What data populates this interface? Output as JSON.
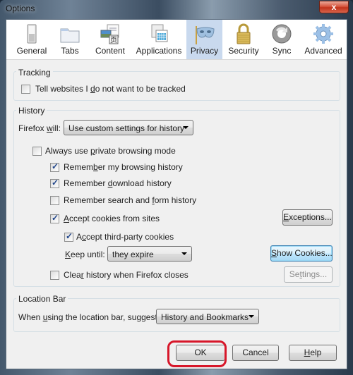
{
  "window": {
    "title": "Options",
    "close_glyph": "x"
  },
  "toolbar": {
    "panes": [
      {
        "id": "general",
        "label": "General",
        "icon": "switch-icon",
        "selected": false
      },
      {
        "id": "tabs",
        "label": "Tabs",
        "icon": "folder-tab-icon",
        "selected": false
      },
      {
        "id": "content",
        "label": "Content",
        "icon": "content-page-icon",
        "selected": false
      },
      {
        "id": "applications",
        "label": "Applications",
        "icon": "applications-icon",
        "selected": false
      },
      {
        "id": "privacy",
        "label": "Privacy",
        "icon": "mask-icon",
        "selected": true
      },
      {
        "id": "security",
        "label": "Security",
        "icon": "padlock-icon",
        "selected": false
      },
      {
        "id": "sync",
        "label": "Sync",
        "icon": "sync-icon",
        "selected": false
      },
      {
        "id": "advanced",
        "label": "Advanced",
        "icon": "gear-icon",
        "selected": false
      }
    ]
  },
  "tracking": {
    "caption": "Tracking",
    "do_not_track": {
      "pre": "Tell websites I ",
      "accel": "d",
      "post": "o not want to be tracked",
      "checked": false
    }
  },
  "history": {
    "caption": "History",
    "firefox_will_label": {
      "pre": "Firefox ",
      "accel": "w",
      "post": "ill:"
    },
    "firefox_will_value": "Use custom settings for history",
    "private_mode": {
      "pre": "Always use ",
      "accel": "p",
      "post": "rivate browsing mode",
      "checked": false
    },
    "remember_browsing": {
      "pre": "Remem",
      "accel": "b",
      "post": "er my browsing history",
      "checked": true
    },
    "remember_download": {
      "pre": "Remember ",
      "accel": "d",
      "post": "ownload history",
      "checked": true
    },
    "remember_search": {
      "pre": "Remember search and ",
      "accel": "f",
      "post": "orm history",
      "checked": false
    },
    "accept_cookies": {
      "pre": "",
      "accel": "A",
      "post": "ccept cookies from sites",
      "checked": true
    },
    "exceptions_button": {
      "pre": "",
      "accel": "E",
      "post": "xceptions..."
    },
    "third_party": {
      "pre": "A",
      "accel": "c",
      "post": "cept third-party cookies",
      "checked": true
    },
    "keep_until_label": {
      "pre": "",
      "accel": "K",
      "post": "eep until:"
    },
    "keep_until_value": "they expire",
    "show_cookies_button": {
      "pre": "",
      "accel": "S",
      "post": "how Cookies..."
    },
    "clear_on_close": {
      "pre": "Clea",
      "accel": "r",
      "post": " history when Firefox closes",
      "checked": false
    },
    "settings_button": {
      "pre": "Se",
      "accel": "t",
      "post": "tings..."
    }
  },
  "location_bar": {
    "caption": "Location Bar",
    "suggest_label": {
      "pre": "When ",
      "accel": "u",
      "post": "sing the location bar, suggest:"
    },
    "suggest_value": "History and Bookmarks"
  },
  "footer": {
    "ok": "OK",
    "cancel": "Cancel",
    "help": {
      "pre": "",
      "accel": "H",
      "post": "elp"
    }
  },
  "colors": {
    "selected_pane": "#c9d9ee",
    "annotation_ring": "#d7172a"
  }
}
